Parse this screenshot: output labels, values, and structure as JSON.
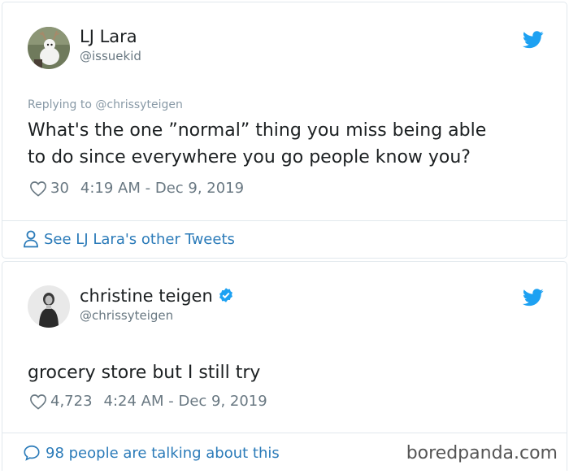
{
  "tweet1": {
    "author_name": "LJ Lara",
    "author_handle": "@issuekid",
    "replying_to": "Replying to @chrissyteigen",
    "text_line1": "What's the one ”normal” thing you miss being able",
    "text_line2": "to do since everywhere you go people know you?",
    "likes": "30",
    "timestamp": "4:19 AM - Dec 9, 2019",
    "footer_link": "See LJ Lara's other Tweets"
  },
  "tweet2": {
    "author_name": "christine teigen",
    "author_handle": "@chrissyteigen",
    "text": "grocery store but I still try",
    "likes": "4,723",
    "timestamp": "4:24 AM - Dec 9, 2019",
    "footer_link": "98 people are talking about this"
  },
  "watermark": "boredpanda.com",
  "icons": {
    "twitter": "twitter-bird-icon",
    "heart": "heart-icon",
    "person": "person-icon",
    "comment": "speech-bubble-icon",
    "verified": "verified-badge-icon"
  },
  "colors": {
    "twitter_blue": "#1da1f2",
    "link_blue": "#2b7bb9",
    "muted_text": "#697882",
    "border": "#e1e8ed"
  }
}
